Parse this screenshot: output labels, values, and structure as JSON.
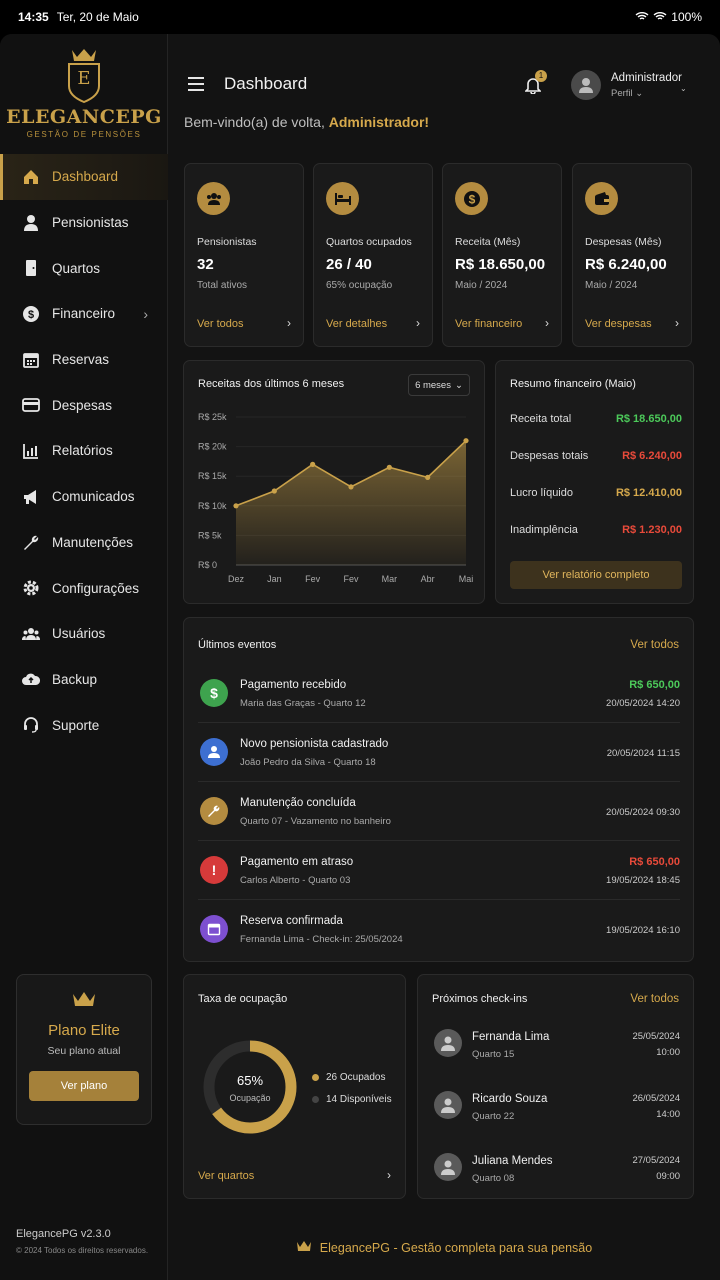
{
  "status": {
    "time": "14:35",
    "date": "Ter, 20 de Maio",
    "battery": "100%"
  },
  "brand": {
    "name": "ELEGANCEPG",
    "tagline": "GESTÃO DE PENSÕES",
    "logo_letter": "E"
  },
  "nav": [
    {
      "label": "Dashboard",
      "icon": "home-icon",
      "active": true
    },
    {
      "label": "Pensionistas",
      "icon": "person-icon"
    },
    {
      "label": "Quartos",
      "icon": "door-icon"
    },
    {
      "label": "Financeiro",
      "icon": "dollar-icon",
      "has_children": true
    },
    {
      "label": "Reservas",
      "icon": "calendar-icon"
    },
    {
      "label": "Despesas",
      "icon": "card-icon"
    },
    {
      "label": "Relatórios",
      "icon": "chart-icon"
    },
    {
      "label": "Comunicados",
      "icon": "megaphone-icon"
    },
    {
      "label": "Manutenções",
      "icon": "wrench-icon"
    },
    {
      "label": "Configurações",
      "icon": "gear-icon"
    },
    {
      "label": "Usuários",
      "icon": "users-icon"
    },
    {
      "label": "Backup",
      "icon": "cloud-icon"
    },
    {
      "label": "Suporte",
      "icon": "headset-icon"
    }
  ],
  "plan": {
    "title": "Plano Elite",
    "subtitle": "Seu plano atual",
    "button": "Ver plano"
  },
  "app_info": {
    "version": "ElegancePG v2.3.0",
    "copyright": "© 2024 Todos os direitos reservados."
  },
  "header": {
    "title": "Dashboard",
    "notifications": "1",
    "user_name": "Administrador",
    "user_role": "Perfil"
  },
  "welcome": {
    "prefix": "Bem-vindo(a) de volta, ",
    "name": "Administrador!"
  },
  "stats": [
    {
      "label": "Pensionistas",
      "value": "32",
      "sub": "Total ativos",
      "link": "Ver todos",
      "icon": "users-icon"
    },
    {
      "label": "Quartos ocupados",
      "value": "26 / 40",
      "sub": "65% ocupação",
      "link": "Ver detalhes",
      "icon": "bed-icon"
    },
    {
      "label": "Receita (Mês)",
      "value": "R$ 18.650,00",
      "sub": "Maio / 2024",
      "link": "Ver financeiro",
      "icon": "dollar-icon"
    },
    {
      "label": "Despesas (Mês)",
      "value": "R$ 6.240,00",
      "sub": "Maio / 2024",
      "link": "Ver despesas",
      "icon": "wallet-icon"
    }
  ],
  "revenue": {
    "title": "Receitas dos últimos 6 meses",
    "range": "6 meses"
  },
  "chart_data": {
    "type": "area",
    "title": "Receitas dos últimos 6 meses",
    "categories": [
      "Dez",
      "Jan",
      "Fev",
      "Fev",
      "Mar",
      "Abr",
      "Mai"
    ],
    "values": [
      10000,
      12500,
      17000,
      13200,
      16500,
      14800,
      21000
    ],
    "y_ticks": [
      "R$ 0",
      "R$ 5k",
      "R$ 10k",
      "R$ 15k",
      "R$ 20k",
      "R$ 25k"
    ],
    "ylim": [
      0,
      25000
    ],
    "color": "#c9a14a"
  },
  "summary": {
    "title": "Resumo financeiro (Maio)",
    "rows": [
      {
        "label": "Receita total",
        "value": "R$ 18.650,00",
        "color": "#4cc95a"
      },
      {
        "label": "Despesas totais",
        "value": "R$ 6.240,00",
        "color": "#e84a3a"
      },
      {
        "label": "Lucro líquido",
        "value": "R$ 12.410,00",
        "color": "#d6a94c"
      },
      {
        "label": "Inadimplência",
        "value": "R$ 1.230,00",
        "color": "#e84a3a"
      }
    ],
    "button": "Ver relatório completo"
  },
  "events": {
    "title": "Últimos eventos",
    "link": "Ver todos",
    "items": [
      {
        "title": "Pagamento recebido",
        "sub": "Maria das Graças - Quarto 12",
        "amount": "R$ 650,00",
        "amount_color": "#4cc95a",
        "date": "20/05/2024 14:20",
        "icon": "dollar-icon",
        "color": "#3ea34e",
        "glyph": "$"
      },
      {
        "title": "Novo pensionista cadastrado",
        "sub": "João Pedro da Silva - Quarto 18",
        "amount": "",
        "date": "20/05/2024 11:15",
        "icon": "person-icon",
        "color": "#3d6fd1",
        "glyph": "👤"
      },
      {
        "title": "Manutenção concluída",
        "sub": "Quarto 07 - Vazamento no banheiro",
        "amount": "",
        "date": "20/05/2024 09:30",
        "icon": "wrench-icon",
        "color": "#b48c40",
        "glyph": "🔧"
      },
      {
        "title": "Pagamento em atraso",
        "sub": "Carlos Alberto - Quarto 03",
        "amount": "R$ 650,00",
        "amount_color": "#e84a3a",
        "date": "19/05/2024 18:45",
        "icon": "alert-icon",
        "color": "#d63a3a",
        "glyph": "!"
      },
      {
        "title": "Reserva confirmada",
        "sub": "Fernanda Lima - Check-in: 25/05/2024",
        "amount": "",
        "date": "19/05/2024 16:10",
        "icon": "calendar-icon",
        "color": "#7d4fd0",
        "glyph": "▦"
      }
    ]
  },
  "occupancy": {
    "title": "Taxa de ocupação",
    "percent": "65%",
    "percent_value": 0.65,
    "label": "Ocupação",
    "occupied": "26 Ocupados",
    "available": "14 Disponíveis",
    "link": "Ver quartos"
  },
  "checkins": {
    "title": "Próximos check-ins",
    "link": "Ver todos",
    "items": [
      {
        "name": "Fernanda Lima",
        "room": "Quarto 15",
        "date": "25/05/2024",
        "time": "10:00"
      },
      {
        "name": "Ricardo Souza",
        "room": "Quarto 22",
        "date": "26/05/2024",
        "time": "14:00"
      },
      {
        "name": "Juliana Mendes",
        "room": "Quarto 08",
        "date": "27/05/2024",
        "time": "09:00"
      }
    ]
  },
  "footer": "ElegancePG - Gestão completa para sua pensão"
}
